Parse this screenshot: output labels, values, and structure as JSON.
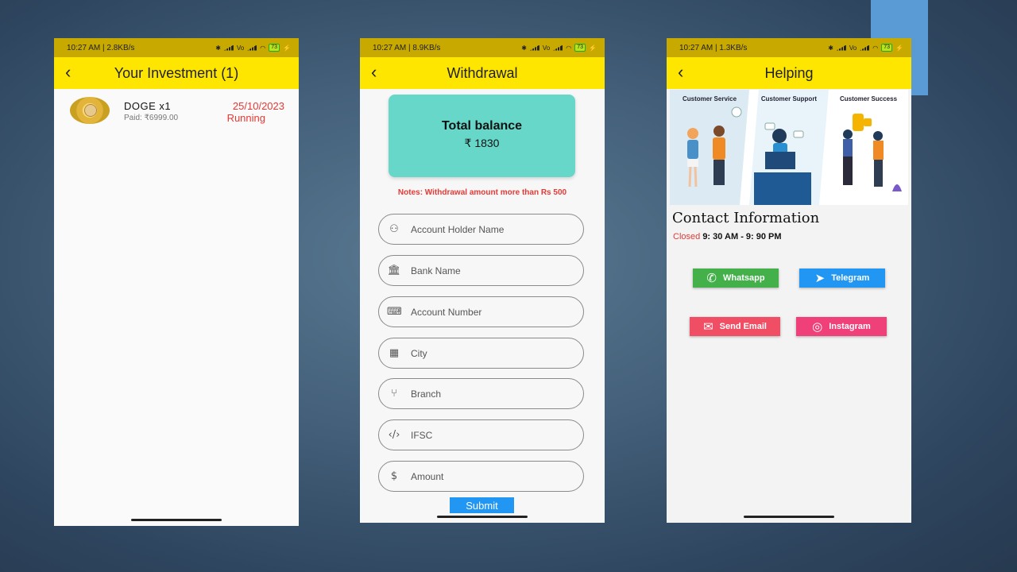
{
  "status_bars": [
    {
      "left": "10:27 AM | 2.8KB/s",
      "battery": "73"
    },
    {
      "left": "10:27 AM | 8.9KB/s",
      "battery": "73"
    },
    {
      "left": "10:27 AM | 1.3KB/s",
      "battery": "73"
    }
  ],
  "investment": {
    "title": "Your Investment (1)",
    "item": {
      "name": "DOGE  x1",
      "paid": "Paid: ₹6999.00",
      "date": "25/10/2023",
      "status": "Running"
    }
  },
  "withdrawal": {
    "title": "Withdrawal",
    "balance_label": "Total balance",
    "balance_value": "₹ 1830",
    "notes": "Notes: Withdrawal amount more than Rs 500",
    "fields": [
      {
        "placeholder": "Account Holder Name",
        "icon": "person-icon"
      },
      {
        "placeholder": "Bank Name",
        "icon": "bank-icon"
      },
      {
        "placeholder": "Account Number",
        "icon": "keyboard-icon"
      },
      {
        "placeholder": "City",
        "icon": "building-icon"
      },
      {
        "placeholder": "Branch",
        "icon": "branch-icon"
      },
      {
        "placeholder": "IFSC",
        "icon": "code-icon"
      },
      {
        "placeholder": "Amount",
        "icon": "dollar-icon"
      }
    ],
    "submit_label": "Submit"
  },
  "helping": {
    "title": "Helping",
    "banner": {
      "service": "Customer Service",
      "support": "Customer Support",
      "success": "Customer Success"
    },
    "contact_title": "Contact Information",
    "closed_label": "Closed",
    "hours": "9: 30 AM - 9: 90 PM",
    "buttons": {
      "whatsapp": "Whatsapp",
      "telegram": "Telegram",
      "email": "Send Email",
      "instagram": "Instagram"
    }
  },
  "colors": {
    "appbar": "#ffe600",
    "statusbar": "#c8a900",
    "balance_card": "#66d7c9",
    "alert": "#e53935",
    "submit": "#2196f3",
    "whatsapp": "#43b049",
    "telegram": "#2196f3",
    "email": "#f04e64",
    "instagram": "#f0407a"
  }
}
